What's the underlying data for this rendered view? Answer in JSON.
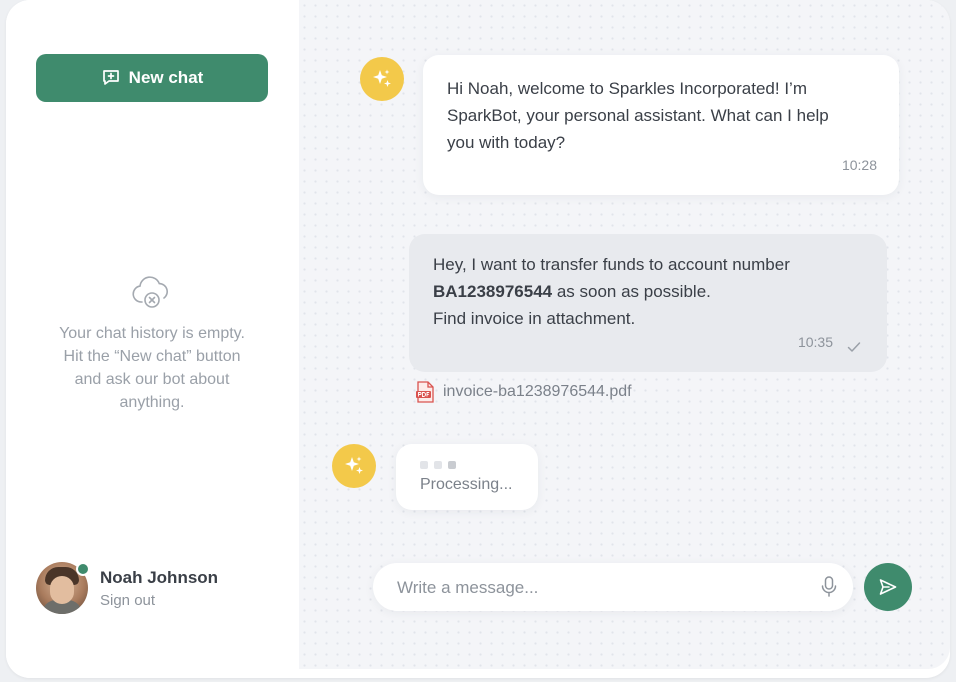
{
  "sidebar": {
    "new_chat_label": "New chat",
    "new_chat_icon": "chat-plus-icon",
    "empty_icon": "cloud-error-icon",
    "empty_line1": "Your chat history is empty.",
    "empty_line2": "Hit the “New chat” button",
    "empty_line3": "and ask our bot about",
    "empty_line4": "anything."
  },
  "user": {
    "name": "Noah Johnson",
    "sign_out": "Sign out",
    "status": "online"
  },
  "chat": {
    "bot_icon": "sparkles-icon",
    "messages": [
      {
        "sender": "bot",
        "line1": "Hi Noah, welcome to Sparkles Incorporated! I’m",
        "line2": "SparkBot, your personal assistant. What can I help",
        "line3": "you with today?",
        "time": "10:28"
      },
      {
        "sender": "user",
        "line1": "Hey, I want to transfer funds to account number",
        "account": "BA1238976544",
        "line2_rest": " as soon as possible.",
        "line3": "Find invoice in attachment.",
        "time": "10:35",
        "status_icon": "check-icon"
      }
    ],
    "attachment": {
      "icon": "pdf-file-icon",
      "filename": "invoice-ba1238976544.pdf"
    },
    "processing_label": "Processing..."
  },
  "composer": {
    "placeholder": "Write a message...",
    "mic_icon": "microphone-icon",
    "send_icon": "send-icon"
  },
  "colors": {
    "accent": "#3f8b6d",
    "bot_avatar": "#f3c94a",
    "chat_bg": "#f4f5f8"
  }
}
